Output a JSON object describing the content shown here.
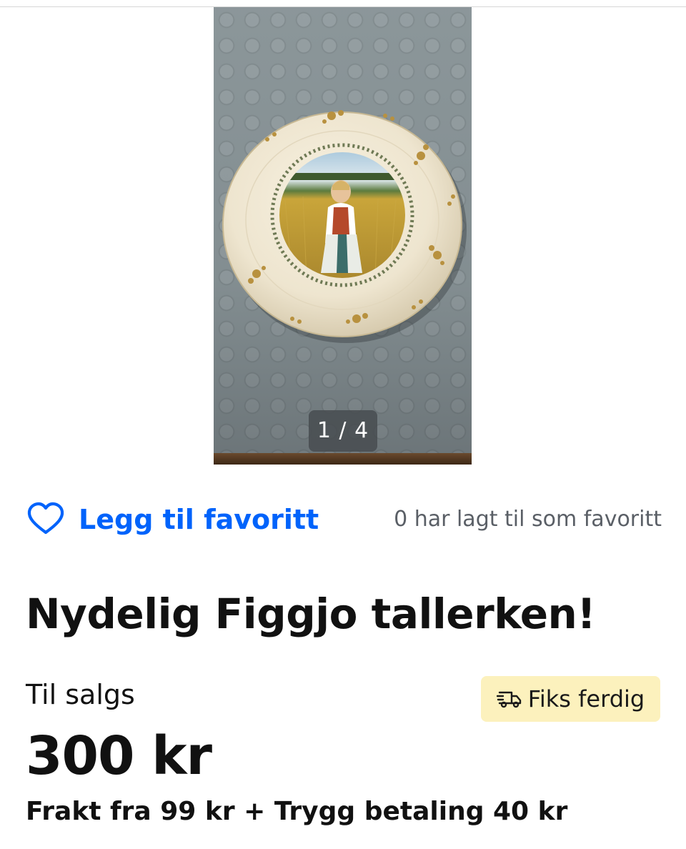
{
  "gallery": {
    "counter": "1 / 4",
    "image_description_icon": "plate-photo"
  },
  "favorite": {
    "button_label": "Legg til favoritt",
    "count_text": "0 har lagt til som favoritt",
    "icon": "heart-icon",
    "color": "#0063fb"
  },
  "listing": {
    "title": "Nydelig Figgjo tallerken!",
    "status": "Til salgs",
    "badge_label": "Fiks ferdig",
    "badge_icon": "truck-icon",
    "badge_color": "#fcf1bd",
    "price": "300 kr",
    "shipping": "Frakt fra 99 kr + Trygg betaling 40 kr"
  }
}
